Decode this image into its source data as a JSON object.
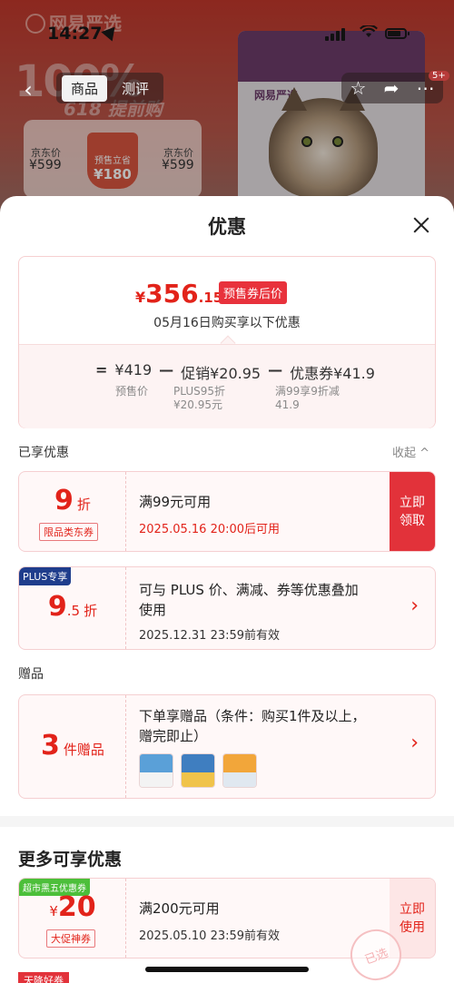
{
  "status": {
    "time": "14:27"
  },
  "background": {
    "brand": "网易严选",
    "headline": "100%",
    "subline": "618 提前购",
    "nav": {
      "tabs": [
        "商品",
        "测评"
      ],
      "badge": "5+"
    },
    "price_box": {
      "left_label": "京东价",
      "left_value": "¥599",
      "mid_label": "预售立省",
      "mid_value": "¥180",
      "right_label": "京东价",
      "right_value": "¥599"
    },
    "product_label": "网易严选"
  },
  "sheet": {
    "title": "优惠",
    "summary": {
      "currency": "¥",
      "price_int": "356",
      "price_dec": ".15",
      "price_tag": "预售券后价",
      "date_line": "05月16日购买享以下优惠",
      "formula": {
        "eq": "=",
        "base": "¥419",
        "minus1": "—",
        "promo": "促销¥20.95",
        "minus2": "—",
        "coupon": "优惠券¥41.9"
      },
      "notes": {
        "base": "预售价",
        "promo_line1": "PLUS95折",
        "promo_line2": "¥20.95元",
        "coupon_line1": "满99享9折减",
        "coupon_line2": "41.9"
      }
    },
    "enjoyed": {
      "label": "已享优惠",
      "collapse": "收起 ^"
    },
    "coupons": [
      {
        "discount": "9",
        "unit": "折",
        "tag": "限品类东券",
        "condition": "满99元可用",
        "time": "2025.05.16 20:00后可用",
        "button": "立即领取"
      },
      {
        "badge": "PLUS专享",
        "discount": "9",
        "discount_dec": ".5",
        "unit": "折",
        "condition_line1": "可与 PLUS 价、满减、券等优惠叠加",
        "condition_line2": "使用",
        "time": "2025.12.31 23:59前有效"
      }
    ],
    "gifts": {
      "label": "赠品",
      "count": "3",
      "unit": "件赠品",
      "desc_line1": "下单享赠品（条件：购买1件及以上，",
      "desc_line2": "赠完即止）"
    },
    "more": {
      "title": "更多可享优惠",
      "coupon": {
        "badge": "超市黑五优惠券",
        "currency": "¥",
        "amount": "20",
        "tag": "大促神券",
        "condition": "满200元可用",
        "time": "2025.05.10 23:59前有效",
        "button": "立即使用",
        "stamp": "已选"
      },
      "next_tag": "天降好券"
    }
  },
  "colors": {
    "accent": "#e2231a",
    "plus": "#1f3d8c",
    "green": "#4cbf3a"
  }
}
